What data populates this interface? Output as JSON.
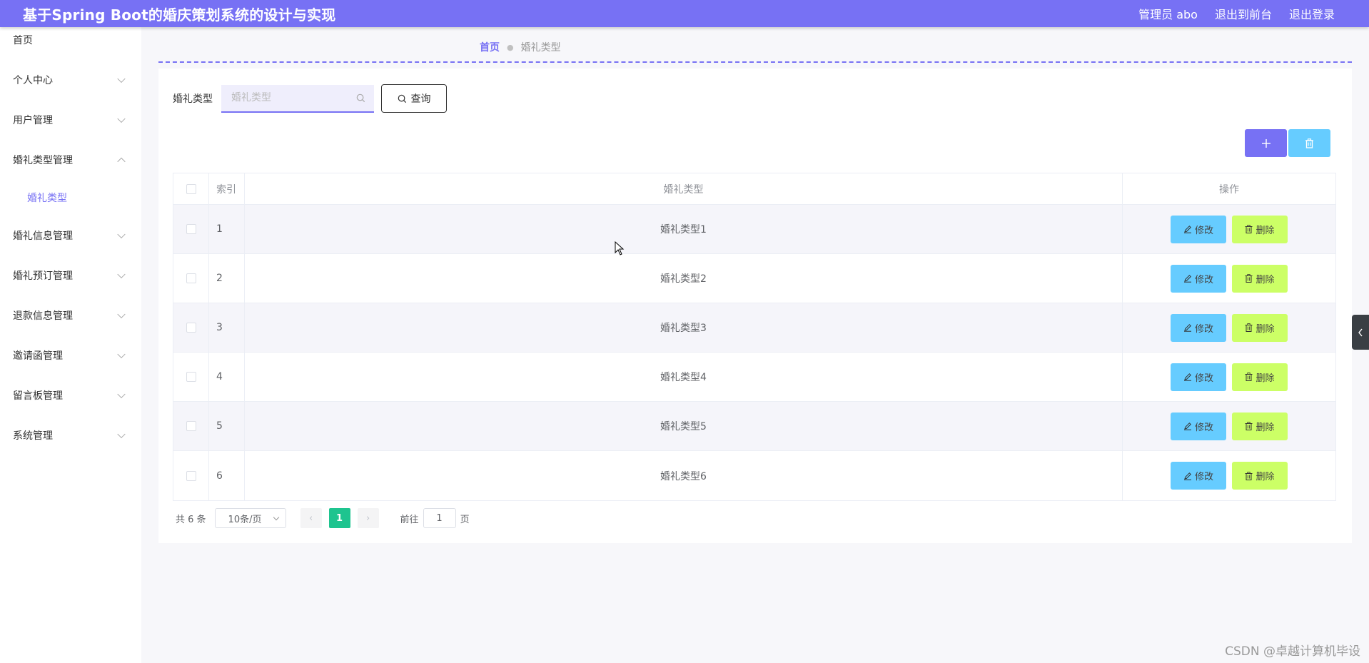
{
  "header": {
    "title": "基于Spring Boot的婚庆策划系统的设计与实现",
    "user_label": "管理员 abo",
    "to_frontend": "退出到前台",
    "logout": "退出登录"
  },
  "sidebar": {
    "items": [
      {
        "label": "首页"
      },
      {
        "label": "个人中心"
      },
      {
        "label": "用户管理"
      },
      {
        "label": "婚礼类型管理",
        "expanded": true,
        "children": [
          {
            "label": "婚礼类型",
            "active": true
          }
        ]
      },
      {
        "label": "婚礼信息管理"
      },
      {
        "label": "婚礼预订管理"
      },
      {
        "label": "退款信息管理"
      },
      {
        "label": "邀请函管理"
      },
      {
        "label": "留言板管理"
      },
      {
        "label": "系统管理"
      }
    ]
  },
  "breadcrumb": {
    "home": "首页",
    "current": "婚礼类型"
  },
  "search": {
    "label": "婚礼类型",
    "placeholder": "婚礼类型",
    "value": "",
    "button": "查询"
  },
  "table": {
    "columns": [
      "",
      "索引",
      "婚礼类型",
      "操作"
    ],
    "rows": [
      {
        "index": "1",
        "name": "婚礼类型1"
      },
      {
        "index": "2",
        "name": "婚礼类型2"
      },
      {
        "index": "3",
        "name": "婚礼类型3"
      },
      {
        "index": "4",
        "name": "婚礼类型4"
      },
      {
        "index": "5",
        "name": "婚礼类型5"
      },
      {
        "index": "6",
        "name": "婚礼类型6"
      }
    ],
    "edit_label": "修改",
    "delete_label": "删除"
  },
  "pagination": {
    "total": "共 6 条",
    "page_size": "10条/页",
    "current_page": "1",
    "goto_label": "前往",
    "goto_value": "1",
    "page_suffix": "页"
  },
  "watermark": "CSDN @卓越计算机毕设",
  "colors": {
    "primary": "#7771f4",
    "edit": "#66ccff",
    "delete": "#ccff66",
    "page_active": "#1ec48f"
  }
}
